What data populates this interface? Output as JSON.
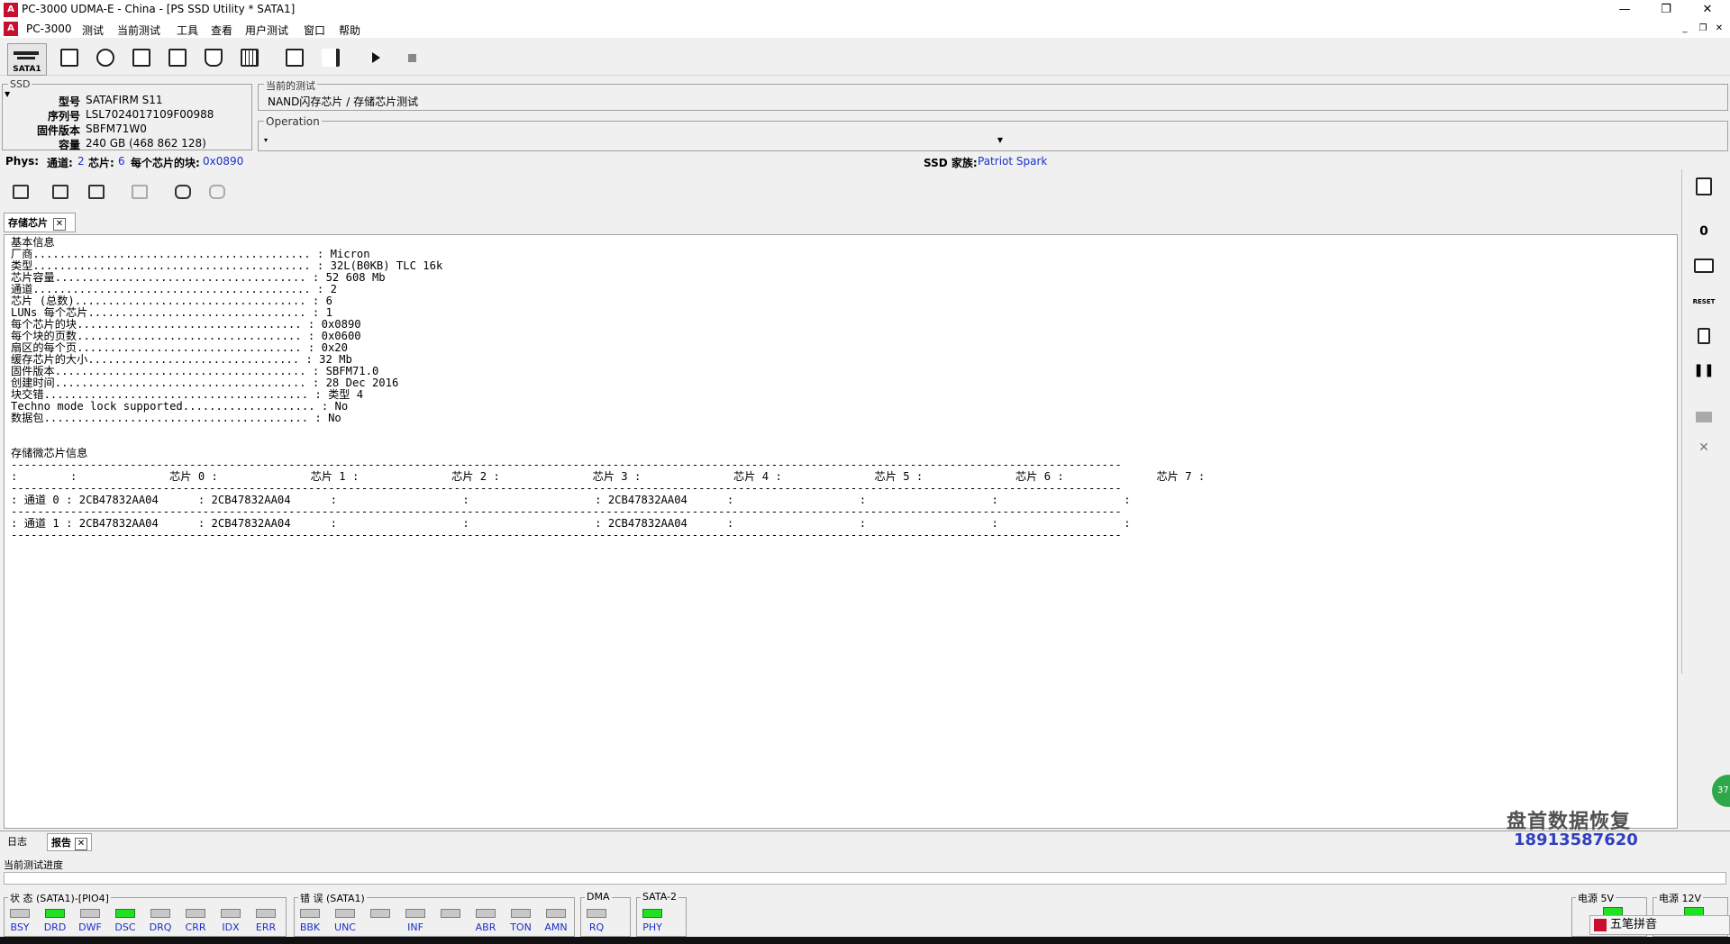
{
  "window": {
    "title": "PC-3000 UDMA-E - China - [PS SSD Utility * SATA1]",
    "icon_text": "A"
  },
  "menu": [
    "PC-3000",
    "测试",
    "当前测试",
    "工具",
    "查看",
    "用户测试",
    "窗口",
    "帮助"
  ],
  "toolbar": {
    "sata_label": "SATA1"
  },
  "ssd": {
    "legend": "SSD",
    "fields": [
      {
        "k": "型号",
        "v": "SATAFIRM   S11"
      },
      {
        "k": "序列号",
        "v": "LSL7024017109F00988"
      },
      {
        "k": "固件版本",
        "v": "SBFM71W0"
      },
      {
        "k": "容量",
        "v": "240 GB (468 862 128)"
      }
    ]
  },
  "current_test": {
    "legend": "当前的测试",
    "value": "NAND闪存芯片 / 存储芯片测试"
  },
  "operation": {
    "legend": "Operation",
    "value": ""
  },
  "phys": {
    "label": "Phys:",
    "channels_label": "通道:",
    "channels": "2",
    "chips_label": "芯片:",
    "chips": "6",
    "blocks_label": "每个芯片的块:",
    "blocks": "0x0890",
    "family_label": "SSD 家族:",
    "family": "Patriot Spark"
  },
  "tab": {
    "label": "存储芯片",
    "close": "✕"
  },
  "report": {
    "basic_title": "基本信息",
    "basic_rows": [
      {
        "k": "厂商",
        "v": "Micron"
      },
      {
        "k": "类型",
        "v": "32L(B0KB) TLC 16k"
      },
      {
        "k": "芯片容量",
        "v": "52 608 Mb"
      },
      {
        "k": "通道",
        "v": "2"
      },
      {
        "k": "芯片 (总数)",
        "v": "6"
      },
      {
        "k": "LUNs 每个芯片",
        "v": "1"
      },
      {
        "k": "每个芯片的块",
        "v": "0x0890"
      },
      {
        "k": "每个块的页数",
        "v": "0x0600"
      },
      {
        "k": "扇区的每个页",
        "v": "0x20"
      },
      {
        "k": "缓存芯片的大小",
        "v": "32 Mb"
      },
      {
        "k": "固件版本",
        "v": "SBFM71.0"
      },
      {
        "k": "创建时间",
        "v": "28 Dec 2016"
      },
      {
        "k": "块交错",
        "v": "类型 4"
      },
      {
        "k": "Techno mode lock supported",
        "v": "No"
      },
      {
        "k": "数据包",
        "v": "No"
      }
    ],
    "chip_title": "存储微芯片信息",
    "chip_headers": [
      "芯片 0",
      "芯片 1",
      "芯片 2",
      "芯片 3",
      "芯片 4",
      "芯片 5",
      "芯片 6",
      "芯片 7"
    ],
    "chip_rows": [
      {
        "label": "通道 0",
        "cells": [
          "2CB47832AA04",
          "2CB47832AA04",
          "",
          "",
          "2CB47832AA04",
          "",
          "",
          ""
        ]
      },
      {
        "label": "通道 1",
        "cells": [
          "2CB47832AA04",
          "2CB47832AA04",
          "",
          "",
          "2CB47832AA04",
          "",
          "",
          ""
        ]
      }
    ]
  },
  "bottom_tabs": {
    "log": "日志",
    "report": "报告",
    "close": "✕"
  },
  "progress_label": "当前测试进度",
  "status_group": {
    "title": "状 态 (SATA1)-[PIO4]",
    "leds": [
      {
        "n": "BSY",
        "on": false
      },
      {
        "n": "DRD",
        "on": true
      },
      {
        "n": "DWF",
        "on": false
      },
      {
        "n": "DSC",
        "on": true
      },
      {
        "n": "DRQ",
        "on": false
      },
      {
        "n": "CRR",
        "on": false
      },
      {
        "n": "IDX",
        "on": false
      },
      {
        "n": "ERR",
        "on": false
      }
    ]
  },
  "error_group": {
    "title": "错 误 (SATA1)",
    "leds": [
      {
        "n": "BBK",
        "on": false
      },
      {
        "n": "UNC",
        "on": false
      },
      {
        "n": "",
        "on": false
      },
      {
        "n": "INF",
        "on": false
      },
      {
        "n": "",
        "on": false
      },
      {
        "n": "ABR",
        "on": false
      },
      {
        "n": "TON",
        "on": false
      },
      {
        "n": "AMN",
        "on": false
      }
    ]
  },
  "dma_group": {
    "title": "DMA",
    "leds": [
      {
        "n": "RQ",
        "on": false
      }
    ]
  },
  "sata_group": {
    "title": "SATA-2",
    "leds": [
      {
        "n": "PHY",
        "on": true
      }
    ]
  },
  "power": {
    "p5": "电源 5V",
    "p12": "电源 12V"
  },
  "watermark": {
    "name": "盘首数据恢复",
    "phone": "18913587620"
  },
  "ime": {
    "text": "五笔拼音"
  },
  "badge": "37"
}
